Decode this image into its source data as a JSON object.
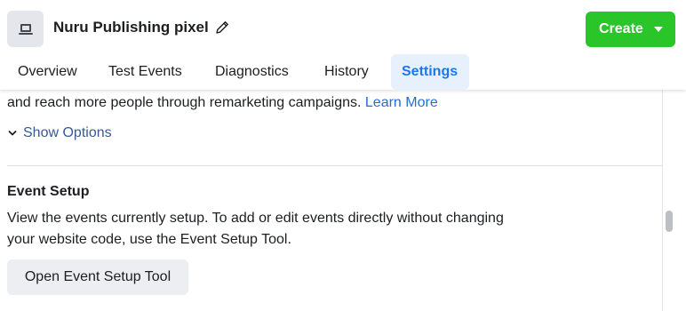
{
  "header": {
    "pixel_icon": "monitor-icon",
    "pixel_name": "Nuru Publishing pixel",
    "edit_icon": "pencil-icon",
    "create_label": "Create",
    "create_caret_icon": "caret-down-icon",
    "create_color": "#2ac629"
  },
  "tabs": [
    {
      "label": "Overview"
    },
    {
      "label": "Test Events"
    },
    {
      "label": "Diagnostics"
    },
    {
      "label": "History"
    },
    {
      "label": "Settings",
      "active": true
    }
  ],
  "remarketing": {
    "text": "and reach more people through remarketing campaigns.",
    "learn_more": "Learn More",
    "show_options": "Show Options",
    "show_options_icon": "chevron-down-icon"
  },
  "event_setup": {
    "title": "Event Setup",
    "description": "View the events currently setup. To add or edit events directly without changing your website code, use the Event Setup Tool.",
    "button_label": "Open Event Setup Tool"
  },
  "colors": {
    "accent": "#1877f2",
    "link": "#216fdb",
    "tab_active_bg": "#e7f0fd"
  }
}
